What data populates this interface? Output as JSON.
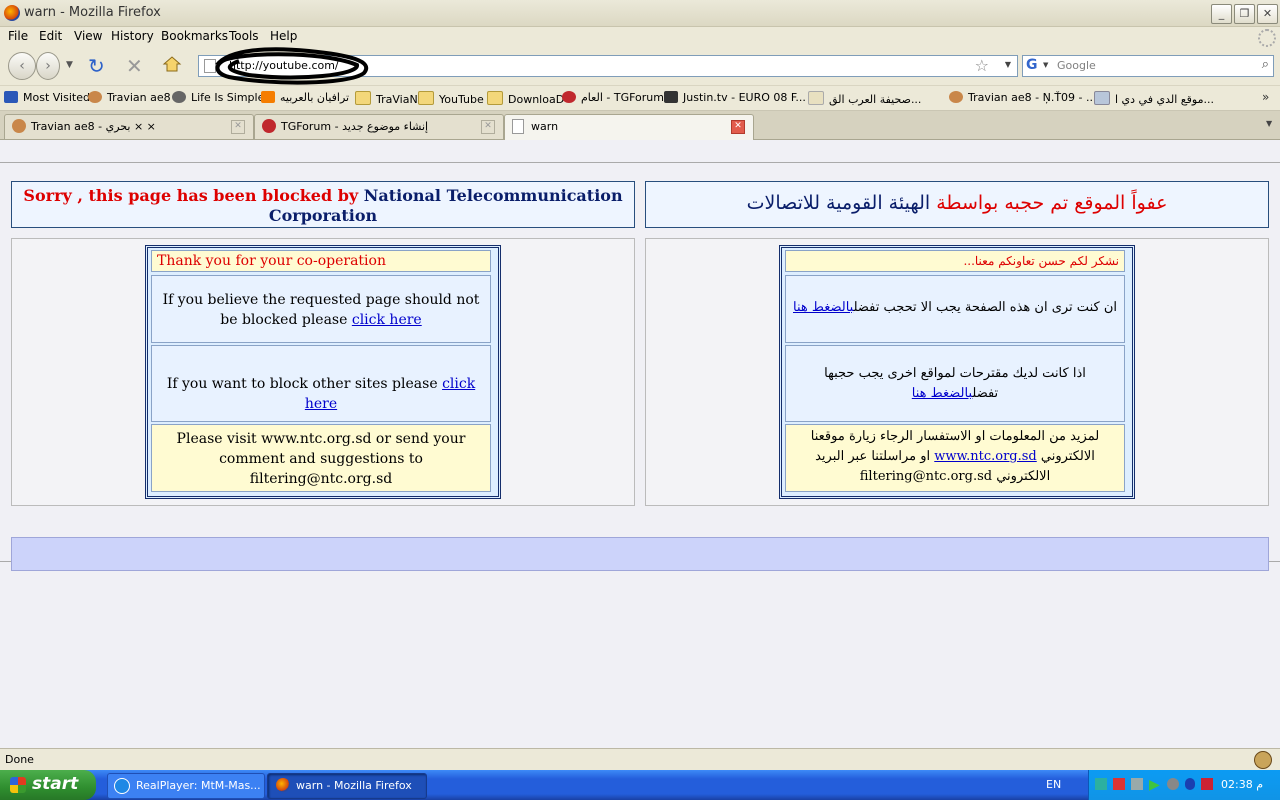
{
  "window": {
    "title": "warn - Mozilla Firefox"
  },
  "menu": {
    "file": "File",
    "edit": "Edit",
    "view": "View",
    "history": "History",
    "bookmarks": "Bookmarks",
    "tools": "Tools",
    "help": "Help"
  },
  "nav": {
    "url": "http://youtube.com/",
    "search_placeholder": "Google",
    "search_engine_glyph": "G"
  },
  "bookmarks": [
    {
      "label": "Most Visited",
      "icon": "folder-icon"
    },
    {
      "label": "Travian ae8",
      "icon": "travian-icon"
    },
    {
      "label": "Life Is Simple",
      "icon": "wordpress-icon"
    },
    {
      "label": "ترافيان بالعربيه",
      "icon": "blogger-icon"
    },
    {
      "label": "TraViaN",
      "icon": "folder-icon"
    },
    {
      "label": "YouTube",
      "icon": "folder-icon"
    },
    {
      "label": "DownloaD",
      "icon": "folder-icon"
    },
    {
      "label": "العام - TGForum",
      "icon": "tgforum-icon"
    },
    {
      "label": "Justin.tv - EURO 08 F...",
      "icon": "justin-icon"
    },
    {
      "label": "صحيفة العرب الق...",
      "icon": "page-icon"
    },
    {
      "label": "Travian ae8 - Ņ.Ť09 - ...",
      "icon": "travian-icon"
    },
    {
      "label": "موقع الدي في دي ا...",
      "icon": "page-icon"
    }
  ],
  "tabs": [
    {
      "label": "Travian ae8 - بحري × ×"
    },
    {
      "label": "TGForum - إنشاء موضوع جديد"
    },
    {
      "label": "warn"
    }
  ],
  "page": {
    "en_header_red": "Sorry , this page has been blocked by",
    "en_header_navy": "National Telecommunication Corporation",
    "ar_header_red": "عفواً الموقع تم حجبه بواسطة",
    "ar_header_navy": "الهيئة القومية للاتصالات",
    "en": {
      "thanks": "Thank you for your co-operation",
      "believe_text": "If you believe the requested page should not be blocked please",
      "click_here_1": "click here",
      "block_text": "If you want to block other sites please",
      "click_here_2": "click here",
      "visit": "Please visit www.ntc.org.sd or send your comment and suggestions to filtering@ntc.org.sd"
    },
    "ar": {
      "thanks": "نشكر لكم حسن تعاونكم معنا...",
      "believe_text": "ان كنت ترى ان هذه الصفحة يجب الا تحجب تفضل",
      "believe_link": "بالضغط هنا",
      "suggest_text": "اذا كانت لديك مقترحات لمواقع اخرى يجب حجبها تفضل",
      "suggest_link": "بالضغط هنا",
      "more_text": "لمزيد من المعلومات او الاستفسار الرجاء زيارة موقعنا الالكتروني",
      "more_link": "www.ntc.org.sd",
      "more_text2": "او مراسلتنا عبر البريد الالكتروني",
      "email": "filtering@ntc.org.sd"
    }
  },
  "status": {
    "text": "Done"
  },
  "taskbar": {
    "start": "start",
    "items": [
      {
        "label": "RealPlayer: MtM-Mas..."
      },
      {
        "label": "warn - Mozilla Firefox"
      }
    ],
    "lang": "EN",
    "clock": "02:38 م"
  }
}
